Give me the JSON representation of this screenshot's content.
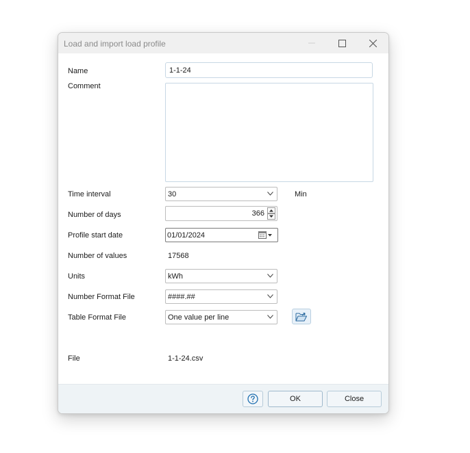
{
  "window": {
    "title": "Load and import load profile"
  },
  "form": {
    "name": {
      "label": "Name",
      "value": "1-1-24"
    },
    "comment": {
      "label": "Comment",
      "value": ""
    },
    "time_interval": {
      "label": "Time interval",
      "value": "30",
      "unit": "Min"
    },
    "num_days": {
      "label": "Number of days",
      "value": "366"
    },
    "start_date": {
      "label": "Profile start date",
      "value": "01/01/2024"
    },
    "num_values": {
      "label": "Number of values",
      "value": "17568"
    },
    "units": {
      "label": "Units",
      "value": "kWh"
    },
    "number_format": {
      "label": "Number Format File",
      "value": "####.##"
    },
    "table_format": {
      "label": "Table Format File",
      "value": "One value per line"
    },
    "file": {
      "label": "File",
      "value": "1-1-24.csv"
    }
  },
  "footer": {
    "ok_label": "OK",
    "close_label": "Close"
  },
  "colors": {
    "accent": "#1f6fb0",
    "footer_bg": "#eef3f6"
  }
}
